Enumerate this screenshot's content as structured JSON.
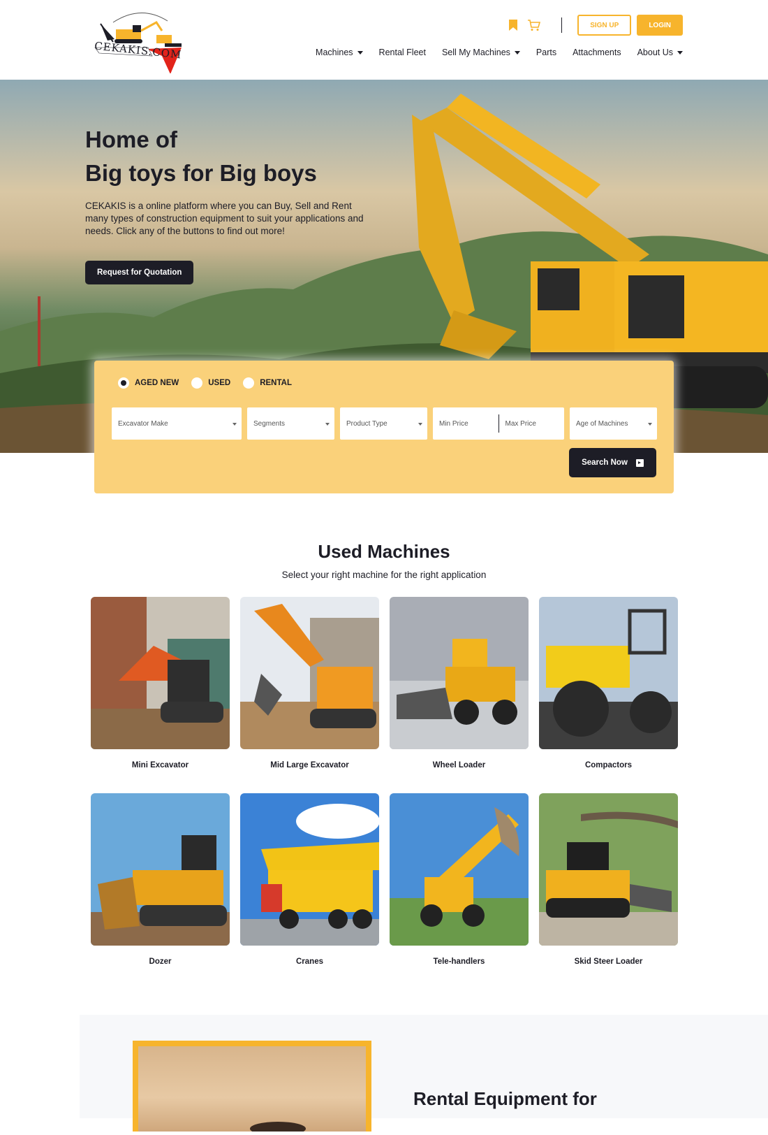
{
  "brand": {
    "name": "CEKAKIS.COM"
  },
  "header": {
    "actions": {
      "bookmark_icon": "bookmark-icon",
      "cart_icon": "cart-icon",
      "signup_label": "SIGN UP",
      "login_label": "LOGIN"
    },
    "nav": [
      {
        "label": "Machines",
        "dropdown": true
      },
      {
        "label": "Rental Fleet",
        "dropdown": false
      },
      {
        "label": "Sell My Machines",
        "dropdown": true
      },
      {
        "label": "Parts",
        "dropdown": false
      },
      {
        "label": "Attachments",
        "dropdown": false
      },
      {
        "label": "About Us",
        "dropdown": true
      }
    ]
  },
  "hero": {
    "title_line1": "Home of",
    "title_line2": "Big toys for Big boys",
    "description": "CEKAKIS is a online platform where you can Buy, Sell and Rent many types of construction equipment to suit your applications and needs. Click any of the buttons to find out more!",
    "cta_label": "Request for Quotation"
  },
  "search": {
    "condition_options": [
      {
        "label": "AGED NEW",
        "selected": true
      },
      {
        "label": "USED",
        "selected": false
      },
      {
        "label": "RENTAL",
        "selected": false
      }
    ],
    "make_placeholder": "Excavator Make",
    "segments_placeholder": "Segments",
    "product_type_placeholder": "Product Type",
    "min_price_placeholder": "Min Price",
    "max_price_placeholder": "Max Price",
    "age_placeholder": "Age of Machines",
    "submit_label": "Search Now"
  },
  "used_machines": {
    "title": "Used Machines",
    "subtitle": "Select your right machine for the right application",
    "items": [
      {
        "label": "Mini Excavator"
      },
      {
        "label": "Mid Large Excavator"
      },
      {
        "label": "Wheel Loader"
      },
      {
        "label": "Compactors"
      },
      {
        "label": "Dozer"
      },
      {
        "label": "Cranes"
      },
      {
        "label": "Tele-handlers"
      },
      {
        "label": "Skid Steer Loader"
      }
    ]
  },
  "rental": {
    "title": "Rental Equipment for"
  },
  "colors": {
    "accent": "#f7b42c",
    "panel": "#fad17a",
    "dark": "#1d1d26"
  }
}
